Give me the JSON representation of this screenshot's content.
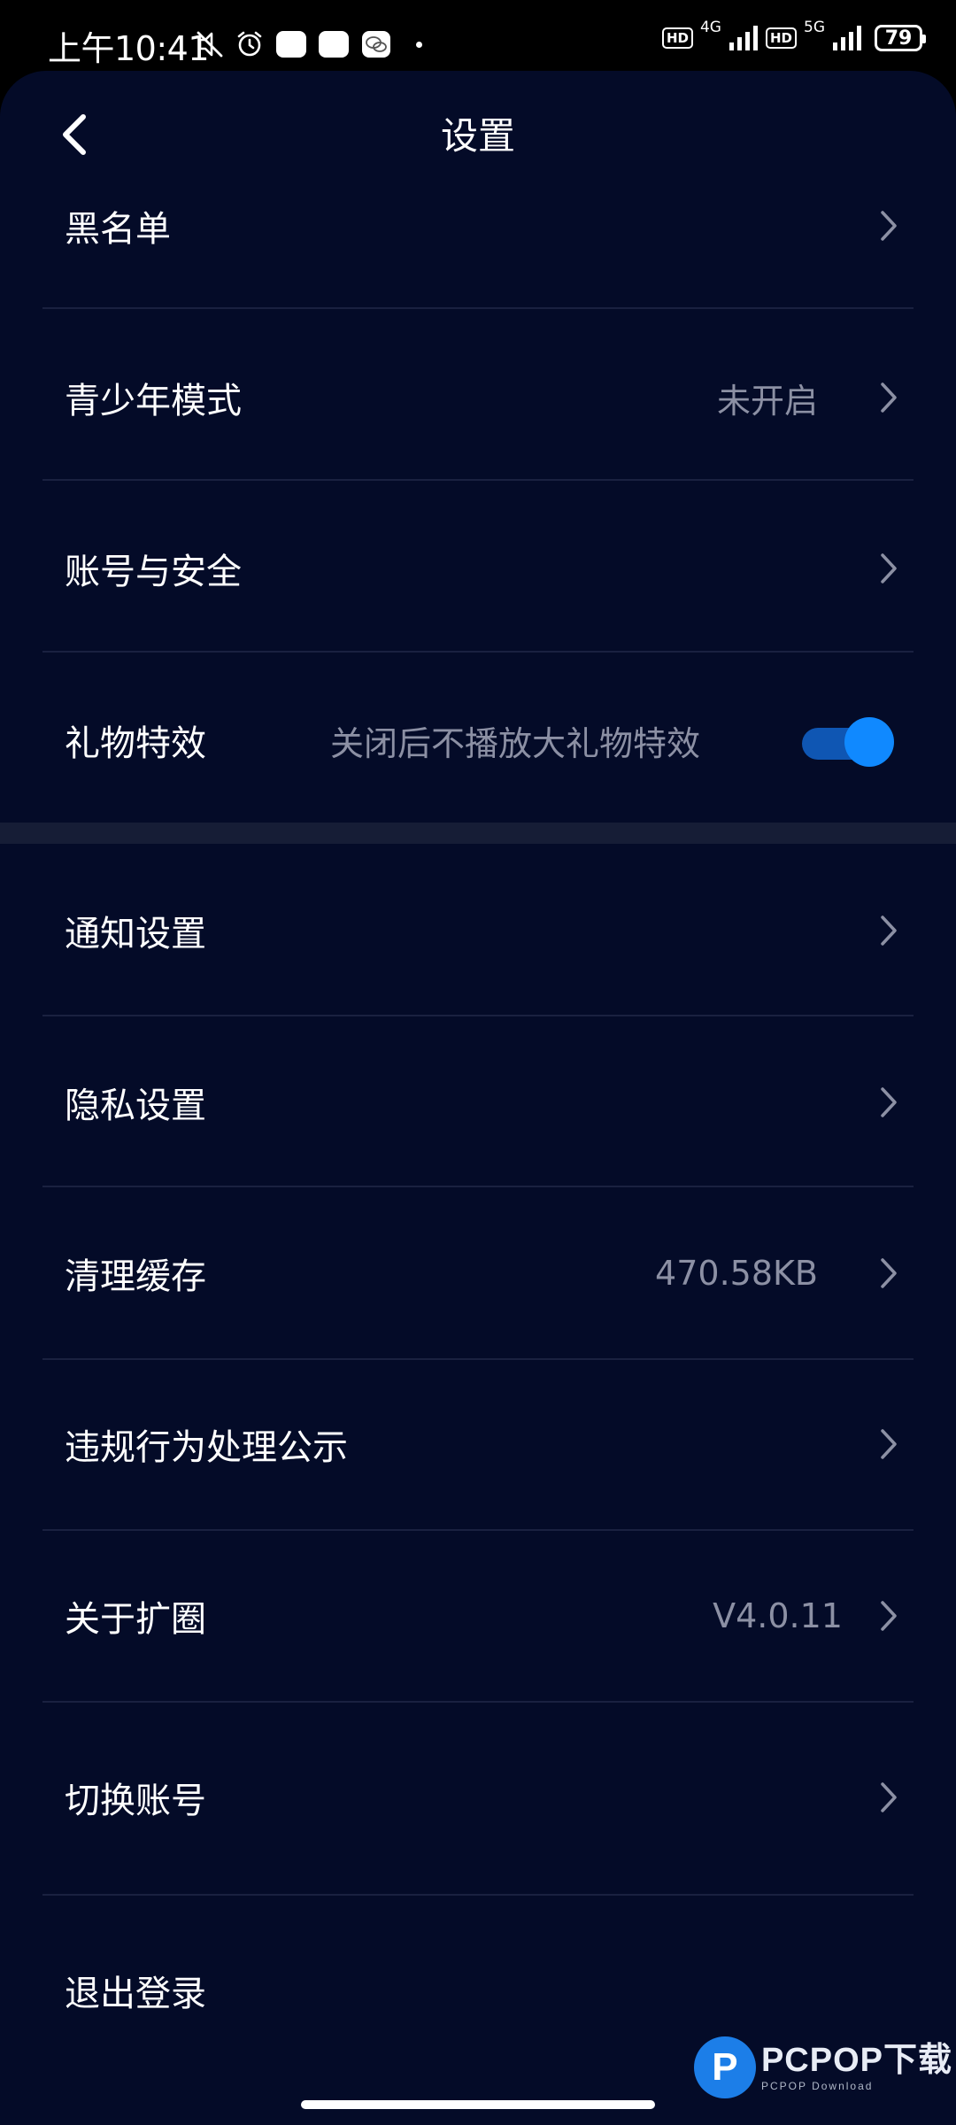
{
  "status_bar": {
    "time": "上午10:41",
    "net1": "4G",
    "net2": "5G",
    "hd": "HD",
    "battery": "79"
  },
  "header": {
    "title": "设置"
  },
  "settings": {
    "blacklist": {
      "label": "黑名单"
    },
    "youth_mode": {
      "label": "青少年模式",
      "value": "未开启"
    },
    "account_security": {
      "label": "账号与安全"
    },
    "gift_effects": {
      "label": "礼物特效",
      "description": "关闭后不播放大礼物特效",
      "enabled": true
    },
    "notifications": {
      "label": "通知设置"
    },
    "privacy": {
      "label": "隐私设置"
    },
    "clear_cache": {
      "label": "清理缓存",
      "value": "470.58KB"
    },
    "violation_notice": {
      "label": "违规行为处理公示"
    },
    "about": {
      "label": "关于扩圈",
      "value": "V4.0.11"
    },
    "switch_account": {
      "label": "切换账号"
    },
    "logout": {
      "label": "退出登录"
    }
  },
  "watermark": {
    "logo_letter": "P",
    "main": "PCPOP下载",
    "sub": "PCPOP Download"
  },
  "colors": {
    "background": "#040b28",
    "toggle_on": "#1089ff",
    "secondary_text": "#8c90a4"
  }
}
